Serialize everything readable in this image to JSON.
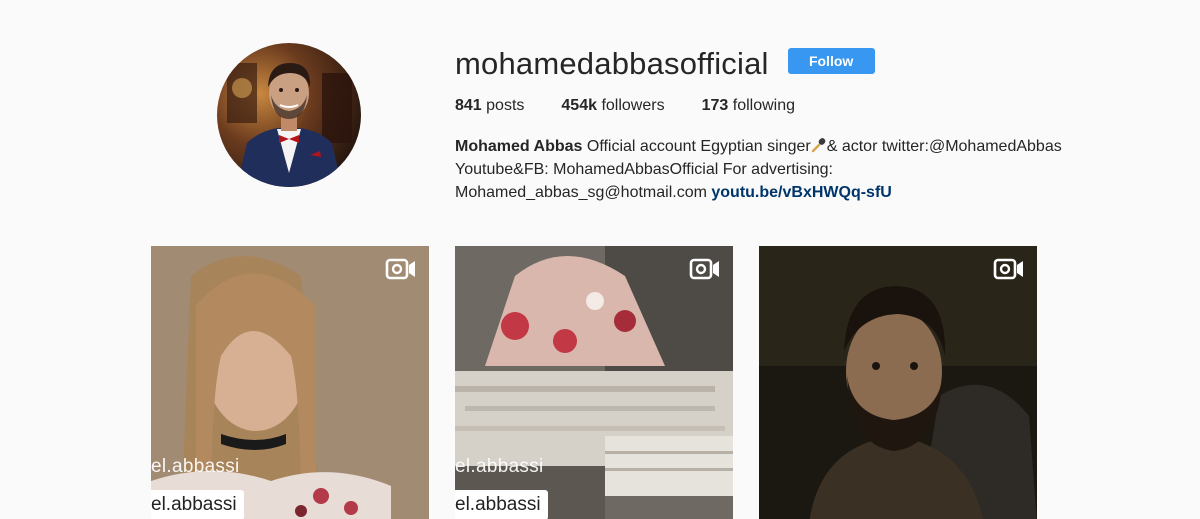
{
  "profile": {
    "username": "mohamedabbasofficial",
    "follow_label": "Follow",
    "stats": {
      "posts_count": "841",
      "posts_label": "posts",
      "followers_count": "454k",
      "followers_label": "followers",
      "following_count": "173",
      "following_label": "following"
    },
    "bio": {
      "full_name": "Mohamed Abbas",
      "text_part1": " Official account Egyptian singer",
      "text_part2": "& actor twitter:@MohamedAbbas",
      "line2": "Youtube&FB: MohamedAbbasOfficial For advertising:",
      "line3": "Mohamed_abbas_sg@hotmail.com ",
      "link": "youtu.be/vBxHWQq-sfU"
    }
  },
  "posts": [
    {
      "type": "video",
      "watermark": "el.abbassi",
      "watermark_box": "el.abbassi"
    },
    {
      "type": "video",
      "watermark": "el.abbassi",
      "watermark_box": "el.abbassi"
    },
    {
      "type": "video"
    }
  ],
  "colors": {
    "background": "#fafafa",
    "follow_button": "#3897f0",
    "link": "#003569",
    "text": "#262626"
  },
  "icons": {
    "video": "video-camera-icon",
    "microphone": "microphone-icon"
  }
}
